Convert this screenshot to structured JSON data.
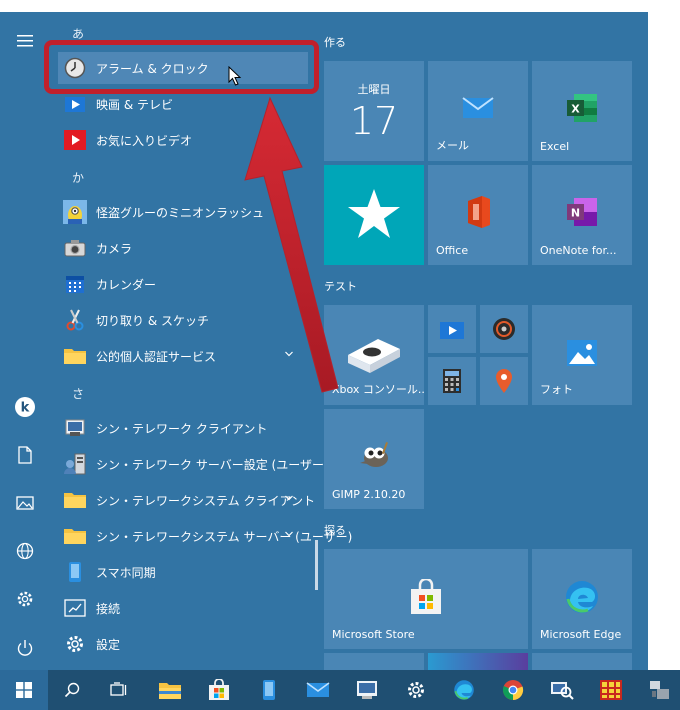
{
  "app_list": {
    "groups": {
      "a": "あ",
      "ka": "か",
      "sa": "さ"
    },
    "items": {
      "alarms": "アラーム & クロック",
      "movies": "映画 & テレビ",
      "favorite_videos": "お気に入りビデオ",
      "minion_rush": "怪盗グルーのミニオンラッシュ",
      "camera": "カメラ",
      "calendar": "カレンダー",
      "snip_sketch": "切り取り & スケッチ",
      "jpki": "公的個人認証サービス",
      "thin_client": "シン・テレワーク クライアント",
      "thin_server_config": "シン・テレワーク サーバー設定 (ユーザー)",
      "thin_system_client": "シン・テレワークシステム クライアント",
      "thin_system_server": "シン・テレワークシステム サーバー (ユーザー)",
      "phone_link": "スマホ同期",
      "connect": "接続",
      "settings": "設定"
    }
  },
  "tiles": {
    "sections": {
      "create": "作る",
      "test": "テスト",
      "explore": "探る"
    },
    "calendar": {
      "weekday": "土曜日",
      "day": "17"
    },
    "mail": "メール",
    "excel": "Excel",
    "office": "Office",
    "onenote": "OneNote for...",
    "xbox": "Xbox コンソール...",
    "photos": "フォト",
    "gimp": "GIMP 2.10.20",
    "store": "Microsoft Store",
    "edge": "Microsoft Edge"
  },
  "colors": {
    "menu_bg": "#3274a4",
    "tile_bg": "#4a86b5",
    "teal_tile": "#00a6b8",
    "taskbar": "#1f4f72",
    "annotation_red": "#c0202c"
  }
}
